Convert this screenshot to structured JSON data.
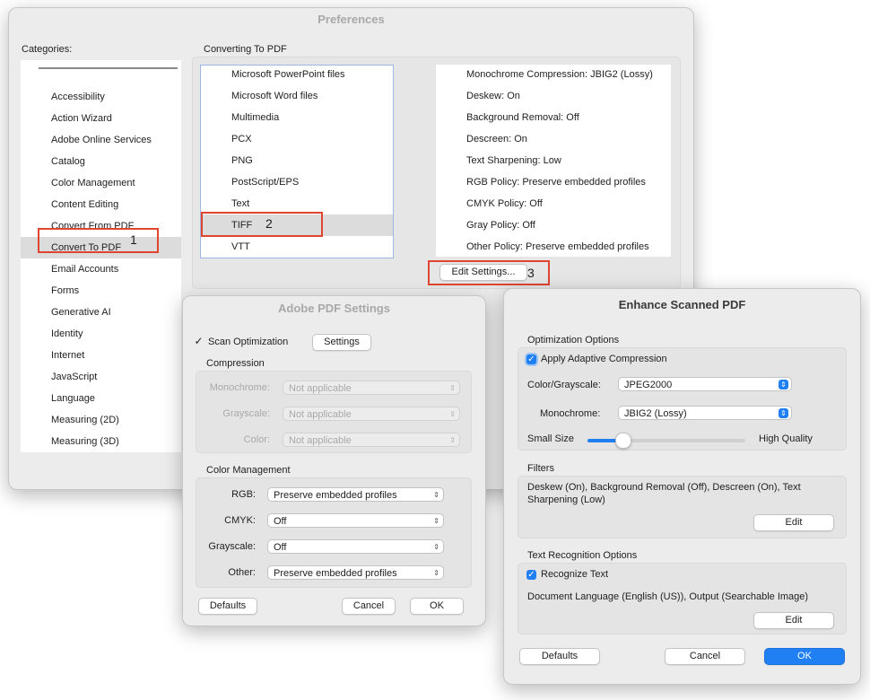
{
  "preferences": {
    "title": "Preferences",
    "categories_label": "Categories:",
    "categories": [
      "Accessibility",
      "Action Wizard",
      "Adobe Online Services",
      "Catalog",
      "Color Management",
      "Content Editing",
      "Convert From PDF",
      "Convert To PDF",
      "Email Accounts",
      "Forms",
      "Generative AI",
      "Identity",
      "Internet",
      "JavaScript",
      "Language",
      "Measuring (2D)",
      "Measuring (3D)"
    ],
    "selected_category": "Convert To PDF",
    "section_label": "Converting To PDF",
    "file_types": [
      "Microsoft PowerPoint files",
      "Microsoft Word files",
      "Multimedia",
      "PCX",
      "PNG",
      "PostScript/EPS",
      "Text",
      "TIFF",
      "VTT"
    ],
    "selected_file_type": "TIFF",
    "settings_summary": [
      "Monochrome Compression: JBIG2 (Lossy)",
      "Deskew: On",
      "Background Removal: Off",
      "Descreen: On",
      "Text Sharpening: Low",
      "RGB Policy: Preserve embedded profiles",
      "CMYK Policy: Off",
      "Gray Policy: Off",
      "Other Policy: Preserve embedded profiles"
    ],
    "edit_settings_label": "Edit Settings...",
    "annotations": [
      "1",
      "2",
      "3"
    ]
  },
  "pdf_settings": {
    "title": "Adobe PDF Settings",
    "scan_optimization_label": "Scan Optimization",
    "scan_optimization_checked": true,
    "settings_button": "Settings",
    "compression_label": "Compression",
    "compression_rows": [
      {
        "label": "Monochrome:",
        "value": "Not applicable"
      },
      {
        "label": "Grayscale:",
        "value": "Not applicable"
      },
      {
        "label": "Color:",
        "value": "Not applicable"
      }
    ],
    "color_management_label": "Color Management",
    "color_rows": [
      {
        "label": "RGB:",
        "value": "Preserve embedded profiles"
      },
      {
        "label": "CMYK:",
        "value": "Off"
      },
      {
        "label": "Grayscale:",
        "value": "Off"
      },
      {
        "label": "Other:",
        "value": "Preserve embedded profiles"
      }
    ],
    "defaults_button": "Defaults",
    "cancel_button": "Cancel",
    "ok_button": "OK"
  },
  "enhance": {
    "title": "Enhance Scanned PDF",
    "optimization_label": "Optimization Options",
    "adaptive_label": "Apply Adaptive Compression",
    "adaptive_checked": true,
    "color_gray_label": "Color/Grayscale:",
    "color_gray_value": "JPEG2000",
    "mono_label": "Monochrome:",
    "mono_value": "JBIG2 (Lossy)",
    "slider_min_label": "Small Size",
    "slider_max_label": "High Quality",
    "slider_value": 0.22,
    "filters_label": "Filters",
    "filters_text": "Deskew (On), Background Removal (Off), Descreen (On), Text Sharpening (Low)",
    "filters_edit": "Edit",
    "ocr_label": "Text Recognition Options",
    "recognize_label": "Recognize Text",
    "recognize_checked": true,
    "ocr_text": "Document Language (English (US)), Output (Searchable Image)",
    "ocr_edit": "Edit",
    "defaults_button": "Defaults",
    "cancel_button": "Cancel",
    "ok_button": "OK"
  },
  "colors": {
    "accent": "#1f7ff3",
    "highlight": "#e0452f"
  }
}
